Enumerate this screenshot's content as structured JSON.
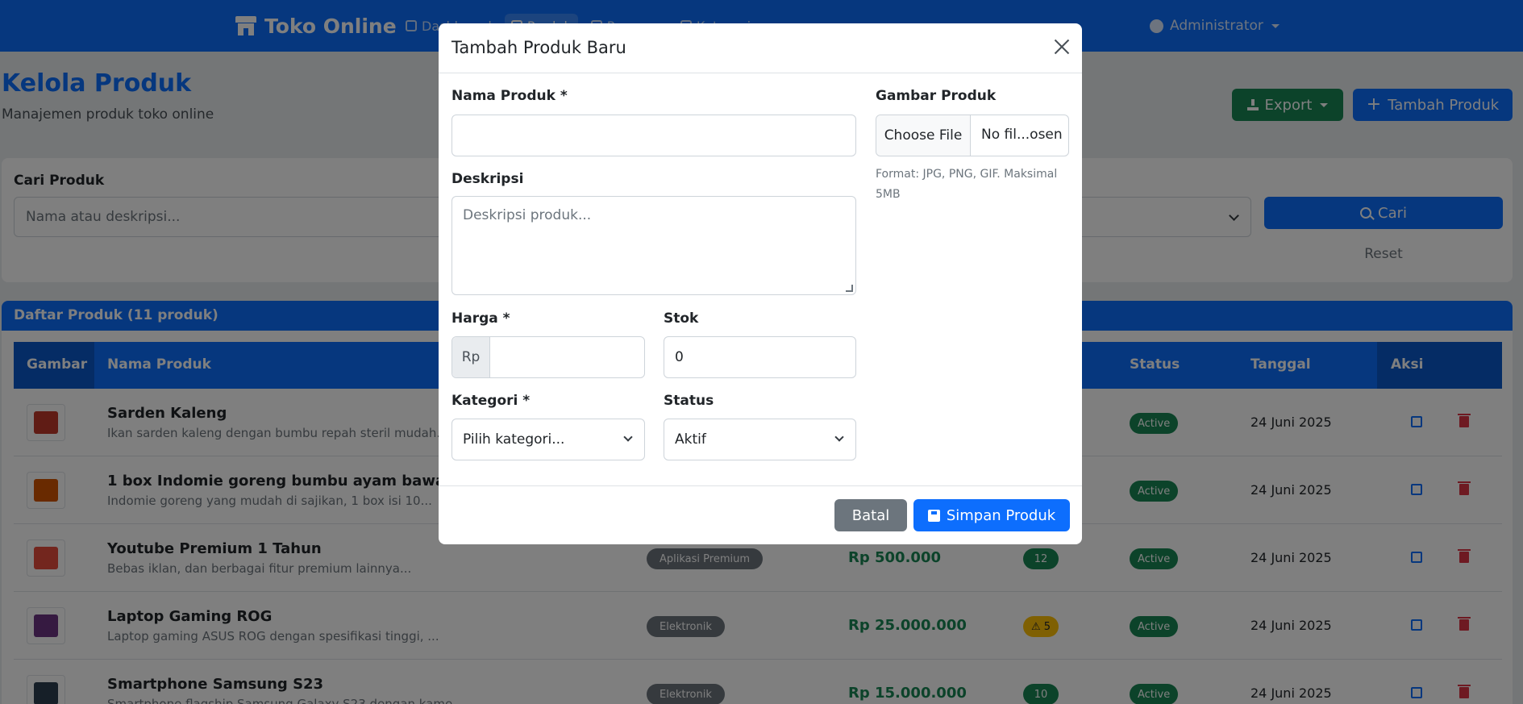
{
  "navbar": {
    "brand": "Toko Online",
    "links": [
      {
        "label": "Dashboard",
        "icon": "dashboard-icon"
      },
      {
        "label": "Produk",
        "icon": "box-icon"
      },
      {
        "label": "Pesanan",
        "icon": "cart-icon"
      },
      {
        "label": "Kategori",
        "icon": "tags-icon"
      }
    ],
    "user": "Administrator"
  },
  "page": {
    "title": "Kelola Produk",
    "subtitle": "Manajemen produk toko online",
    "export_label": "Export",
    "add_label": "Tambah Produk"
  },
  "search": {
    "label": "Cari Produk",
    "placeholder": "Nama atau deskripsi...",
    "search_label": "Cari",
    "reset_label": "Reset"
  },
  "table": {
    "title": "Daftar Produk (11 produk)",
    "headers": [
      "Gambar",
      "Nama Produk",
      "Status",
      "Tanggal",
      "Aksi"
    ],
    "rows": [
      {
        "name": "Sarden Kaleng",
        "desc": "Ikan sarden kaleng dengan bumbu repah steril mudah...",
        "category": "",
        "price": "",
        "stock": "",
        "status": "Active",
        "date": "24 Juni 2025",
        "thumb_color": "#c0392b"
      },
      {
        "name": "1 box Indomie goreng bumbu ayam bawang goren",
        "desc": "Indomie goreng yang mudah di sajikan, 1 box isi 10...",
        "category": "",
        "price": "",
        "stock": "",
        "status": "Active",
        "date": "24 Juni 2025",
        "thumb_color": "#d35400"
      },
      {
        "name": "Youtube Premium 1 Tahun",
        "desc": "Bebas iklan, dan berbagai fitur premium lainnya...",
        "category": "Aplikasi Premium",
        "price": "Rp 500.000",
        "stock": "12",
        "status": "Active",
        "date": "24 Juni 2025",
        "thumb_color": "#e74c3c"
      },
      {
        "name": "Laptop Gaming ROG",
        "desc": "Laptop gaming ASUS ROG dengan spesifikasi tinggi, ...",
        "category": "Elektronik",
        "price": "Rp 25.000.000",
        "stock": "5",
        "stock_warn": true,
        "status": "Active",
        "date": "24 Juni 2025",
        "thumb_color": "#6c3483"
      },
      {
        "name": "Smartphone Samsung S23",
        "desc": "Smartphone flagship Samsung Galaxy S23 dengan kame...",
        "category": "Elektronik",
        "price": "Rp 15.000.000",
        "stock": "10",
        "status": "Active",
        "date": "24 Juni 2025",
        "thumb_color": "#2c3e50"
      }
    ]
  },
  "modal": {
    "title": "Tambah Produk Baru",
    "name_label": "Nama Produk *",
    "name_value": "",
    "desc_label": "Deskripsi",
    "desc_placeholder": "Deskripsi produk...",
    "price_label": "Harga *",
    "price_prefix": "Rp",
    "price_value": "",
    "stock_label": "Stok",
    "stock_value": "0",
    "category_label": "Kategori *",
    "category_value": "Pilih kategori...",
    "status_label": "Status",
    "status_value": "Aktif",
    "image_label": "Gambar Produk",
    "file_button": "Choose File",
    "file_name": "No fil...osen",
    "file_help": "Format: JPG, PNG, GIF. Maksimal 5MB",
    "cancel_label": "Batal",
    "save_label": "Simpan Produk"
  },
  "colors": {
    "primary": "#0d6efd",
    "success": "#198754",
    "secondary": "#6c757d",
    "warning": "#ffc107",
    "danger": "#dc3545"
  }
}
